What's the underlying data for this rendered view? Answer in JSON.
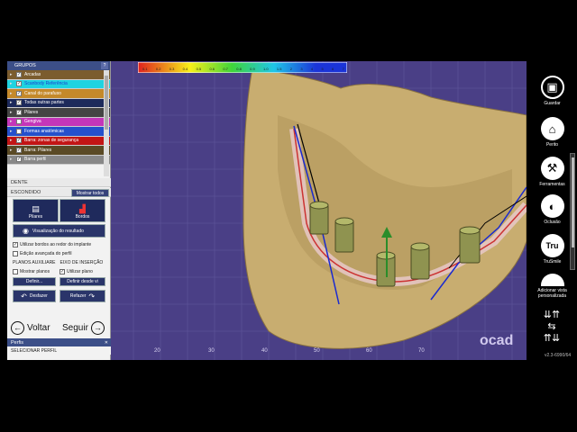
{
  "groups": {
    "header": "GRUPOS",
    "help": "?",
    "items": [
      {
        "label": "Arcadas",
        "color": "#7b5c2e",
        "checked": true
      },
      {
        "label": "Scanbody Referência",
        "color": "#1fd3e0",
        "checked": true
      },
      {
        "label": "Canal do parafuso",
        "color": "#c4892a",
        "checked": true
      },
      {
        "label": "Todas outras partes",
        "color": "#1d2a5b",
        "checked": true
      },
      {
        "label": "Pilares",
        "color": "#444444",
        "checked": true
      },
      {
        "label": "Gengiva",
        "color": "#c436b9",
        "checked": false
      },
      {
        "label": "Formas anatómicas",
        "color": "#2550cc",
        "checked": false
      },
      {
        "label": "Barra: zonas de segurança",
        "color": "#c21515",
        "checked": true
      },
      {
        "label": "Barra: Pilares",
        "color": "#5a4a25",
        "checked": true
      },
      {
        "label": "Barra perfil",
        "color": "#888888",
        "checked": true
      }
    ]
  },
  "dente": "DENTE",
  "escondido": "ESCONDIDO",
  "mostrar_todos": "Mostrar todos",
  "btn_pilares": "Pilares",
  "btn_bordos": "Bordos",
  "btn_visualizacao": "Visualização do resultado",
  "opt_utilizar_bordos": "Utilizar bordos ao redor do implante",
  "opt_edicao": "Edição avançada do perfil",
  "planos_label": "PLANOS AUXILIARE",
  "eixo_label": "EIXO DE INSERÇÃO",
  "opt_mostrar_planos": "Mostrar planos",
  "opt_utilizar_plano": "Utilizar plano",
  "definir": "Definir...",
  "definir_desde": "Definir desde vi",
  "desfazer": "Desfazer",
  "refazer": "Refazer",
  "voltar": "Voltar",
  "seguir": "Seguir",
  "perfis_header": "Perfis",
  "perfis_close": "✕",
  "selecionar_perfil": "SELECIONAR PERFIL",
  "colorbar_ticks": [
    "0.1",
    "0.2",
    "0.3",
    "0.4",
    "0.5",
    "0.6",
    "0.7",
    "0.8",
    "0.9",
    "1.0",
    "1.5",
    "2",
    "3",
    "4",
    "5",
    "6",
    "7"
  ],
  "ruler_ticks": [
    "20",
    "30",
    "40",
    "50",
    "60",
    "70"
  ],
  "brand_mark": "ocad",
  "toolbar": [
    {
      "label": "Guardar",
      "icon": "save-icon",
      "glyph": "💾"
    },
    {
      "label": "Perito",
      "icon": "graduation-cap-icon",
      "glyph": "🎓"
    },
    {
      "label": "Ferramentas",
      "icon": "tools-icon",
      "glyph": "⚒"
    },
    {
      "label": "Oclusão",
      "icon": "occlusion-icon",
      "glyph": "◐"
    },
    {
      "label": "TruSmile",
      "icon": "trusmile-icon",
      "glyph": "Tru"
    },
    {
      "label": "Adicionar vista personalizada",
      "icon": "custom-view-icon",
      "glyph": ""
    }
  ],
  "version": "v2.3-6990/64",
  "colors": {
    "viewport_bg": "#4a3f86",
    "panel_dark": "#1f2a5c",
    "header_blue": "#3c4f88",
    "model": "#c8ad70"
  }
}
